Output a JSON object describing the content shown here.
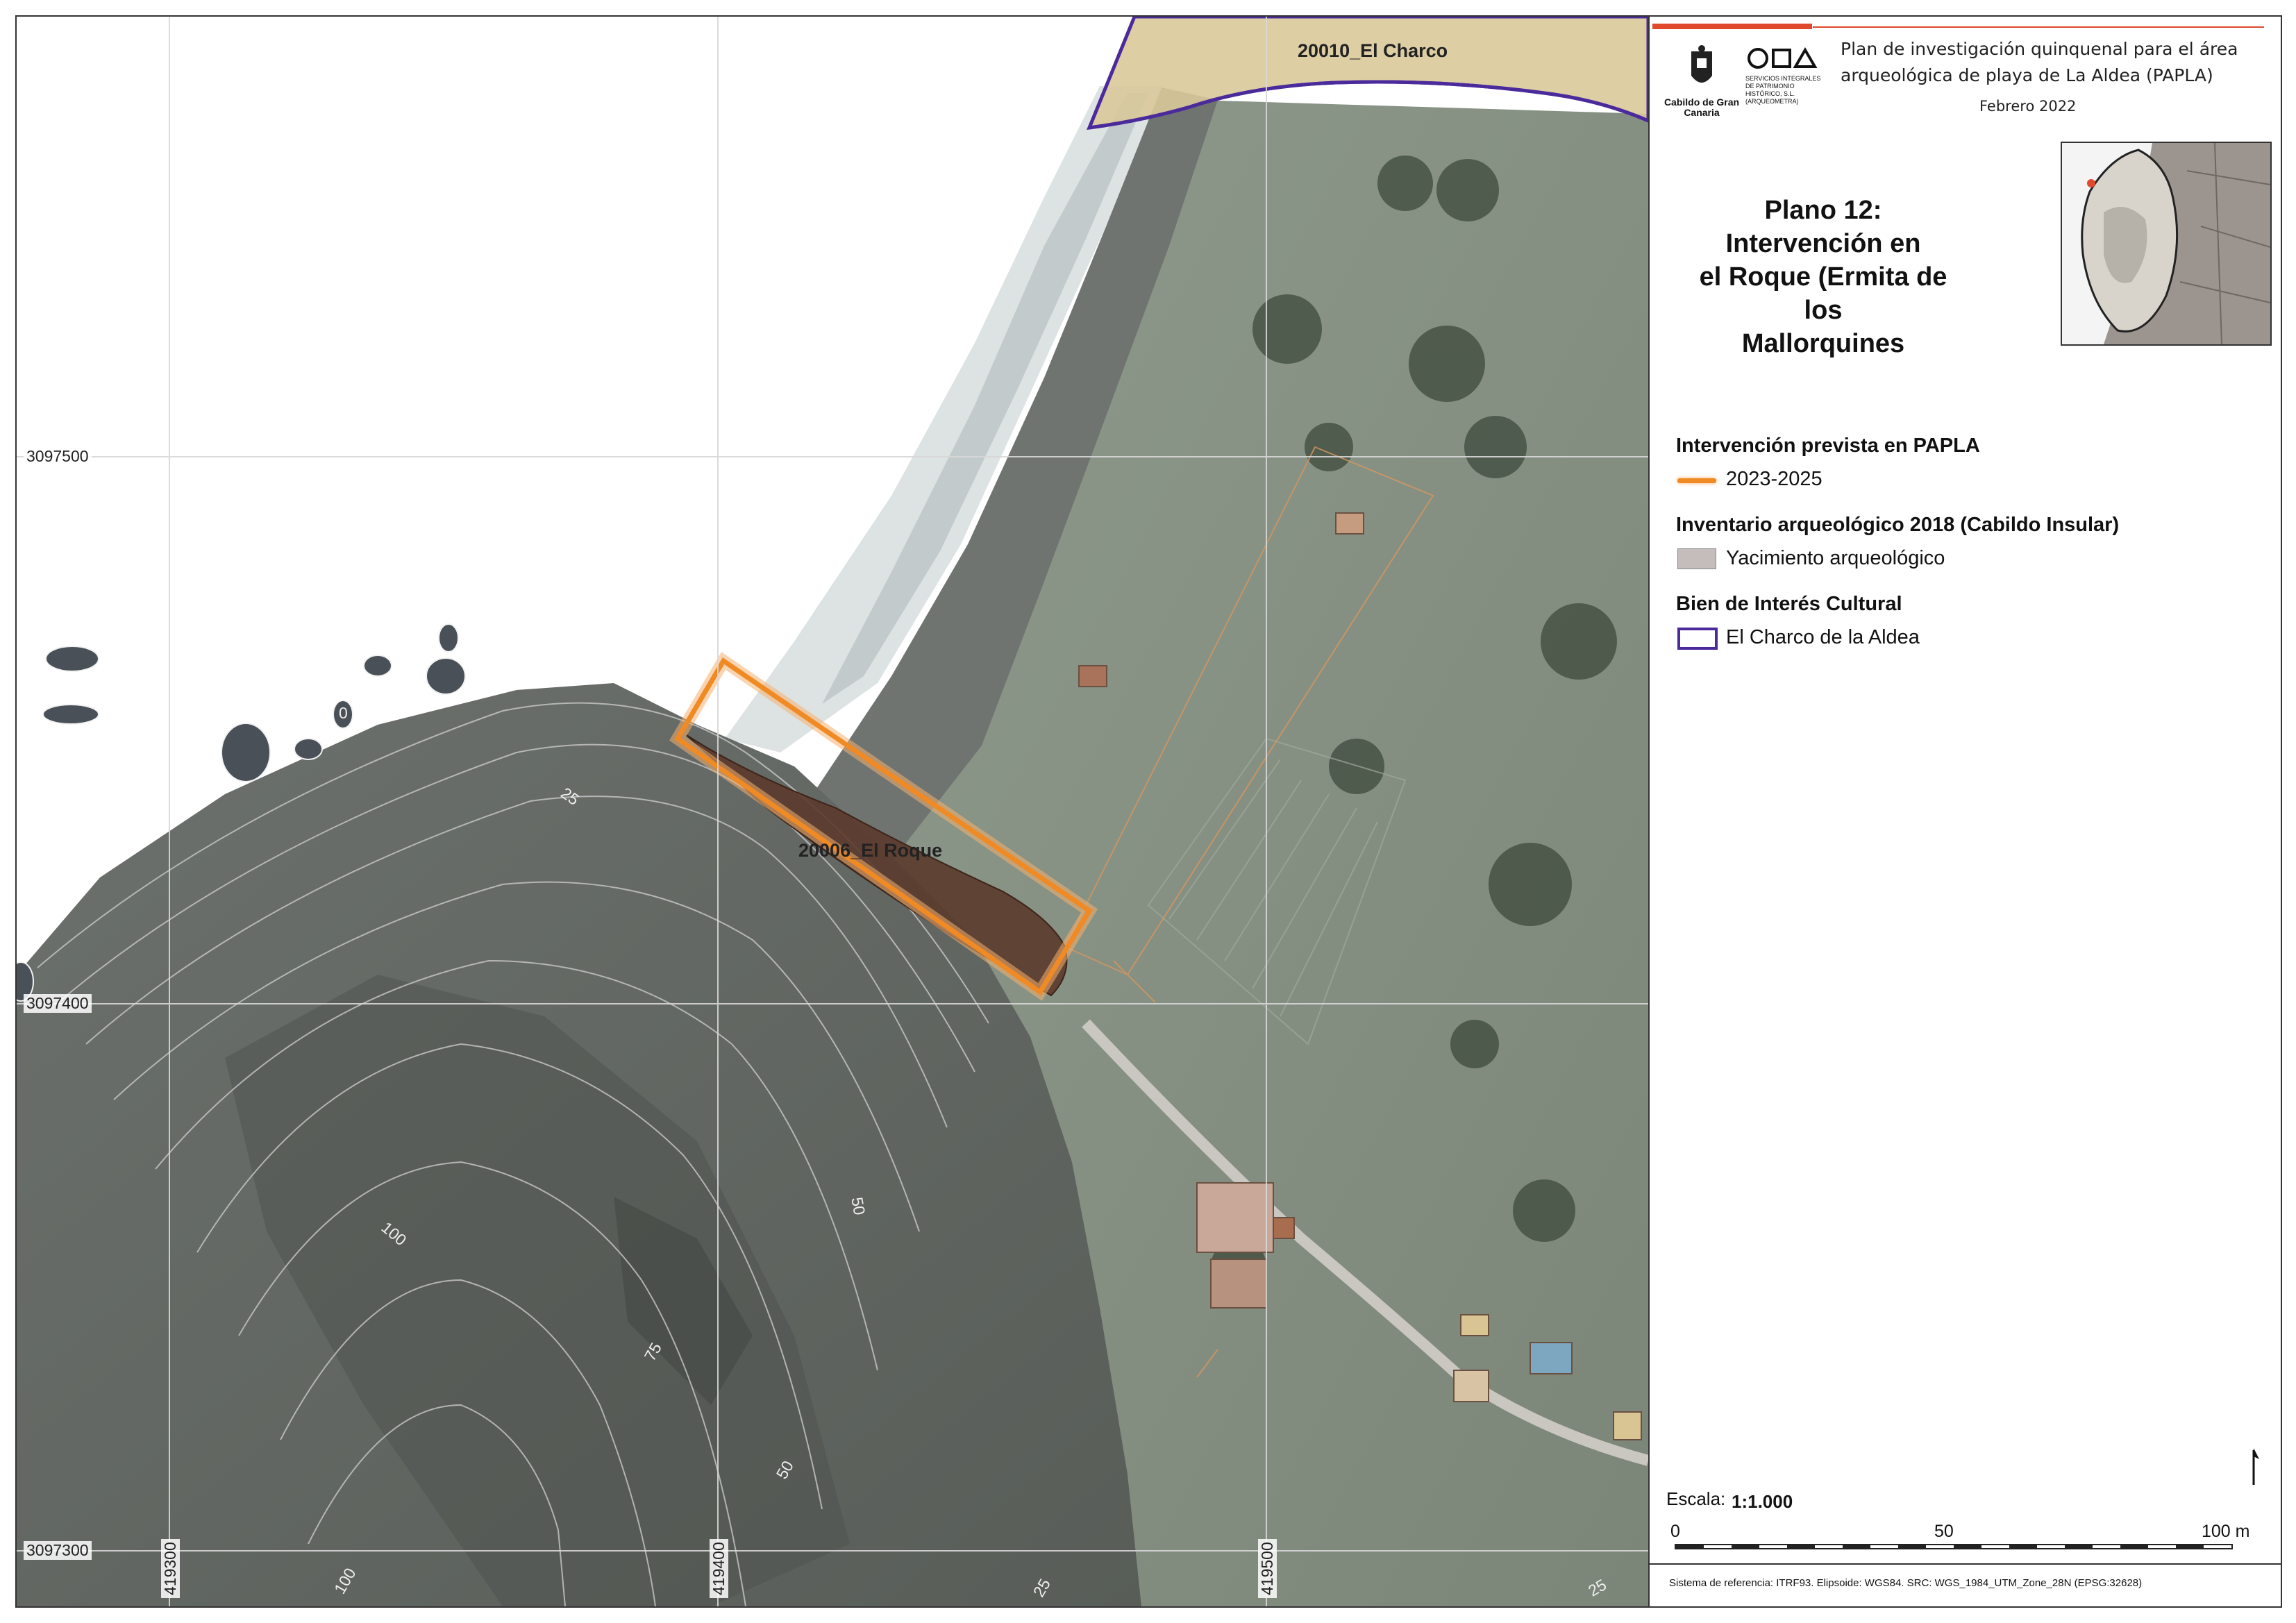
{
  "map": {
    "labels": {
      "el_charco": "20010_El Charco",
      "el_roque": "20006_El Roque"
    },
    "grid_northings": [
      "3097500",
      "3097400",
      "3097300"
    ],
    "grid_eastings": [
      "419300",
      "419400",
      "419500"
    ],
    "contours": [
      "0",
      "25",
      "25",
      "25",
      "50",
      "50",
      "75",
      "100",
      "100"
    ]
  },
  "header": {
    "logo_cabildo": "Cabildo de Gran Canaria",
    "logo_company": "SERVICIOS INTEGRALES DE PATRIMONIO HISTÓRICO, S.L. (ARQUEOMETRA)",
    "project_line1": "Plan de investigación quinquenal para el área",
    "project_line2": "arqueológica de playa de La Aldea (PAPLA)",
    "date": "Febrero 2022"
  },
  "plan": {
    "title_line1": "Plano 12:  Intervención en",
    "title_line2": "el Roque (Ermita de los",
    "title_line3": "Mallorquines"
  },
  "legend": {
    "group1_title": "Intervención prevista en PAPLA",
    "group1_item": "2023-2025",
    "group2_title": "Inventario arqueológico 2018 (Cabildo Insular)",
    "group2_item": "Yacimiento arqueológico",
    "group3_title": "Bien de Interés Cultural",
    "group3_item": "El Charco de la Aldea"
  },
  "scale": {
    "label": "Escala:",
    "value": "1:1.000",
    "tick0": "0",
    "tick1": "50",
    "tick2": "100 m"
  },
  "reference": "Sistema de referencia: ITRF93. Elipsoide: WGS84. SRC: WGS_1984_UTM_Zone_28N (EPSG:32628)",
  "colors": {
    "intervention": "#f08a24",
    "archaeological_site": "#c5bcbc",
    "bic_boundary": "#4b2a9c",
    "accent_bar": "#e0492c"
  }
}
